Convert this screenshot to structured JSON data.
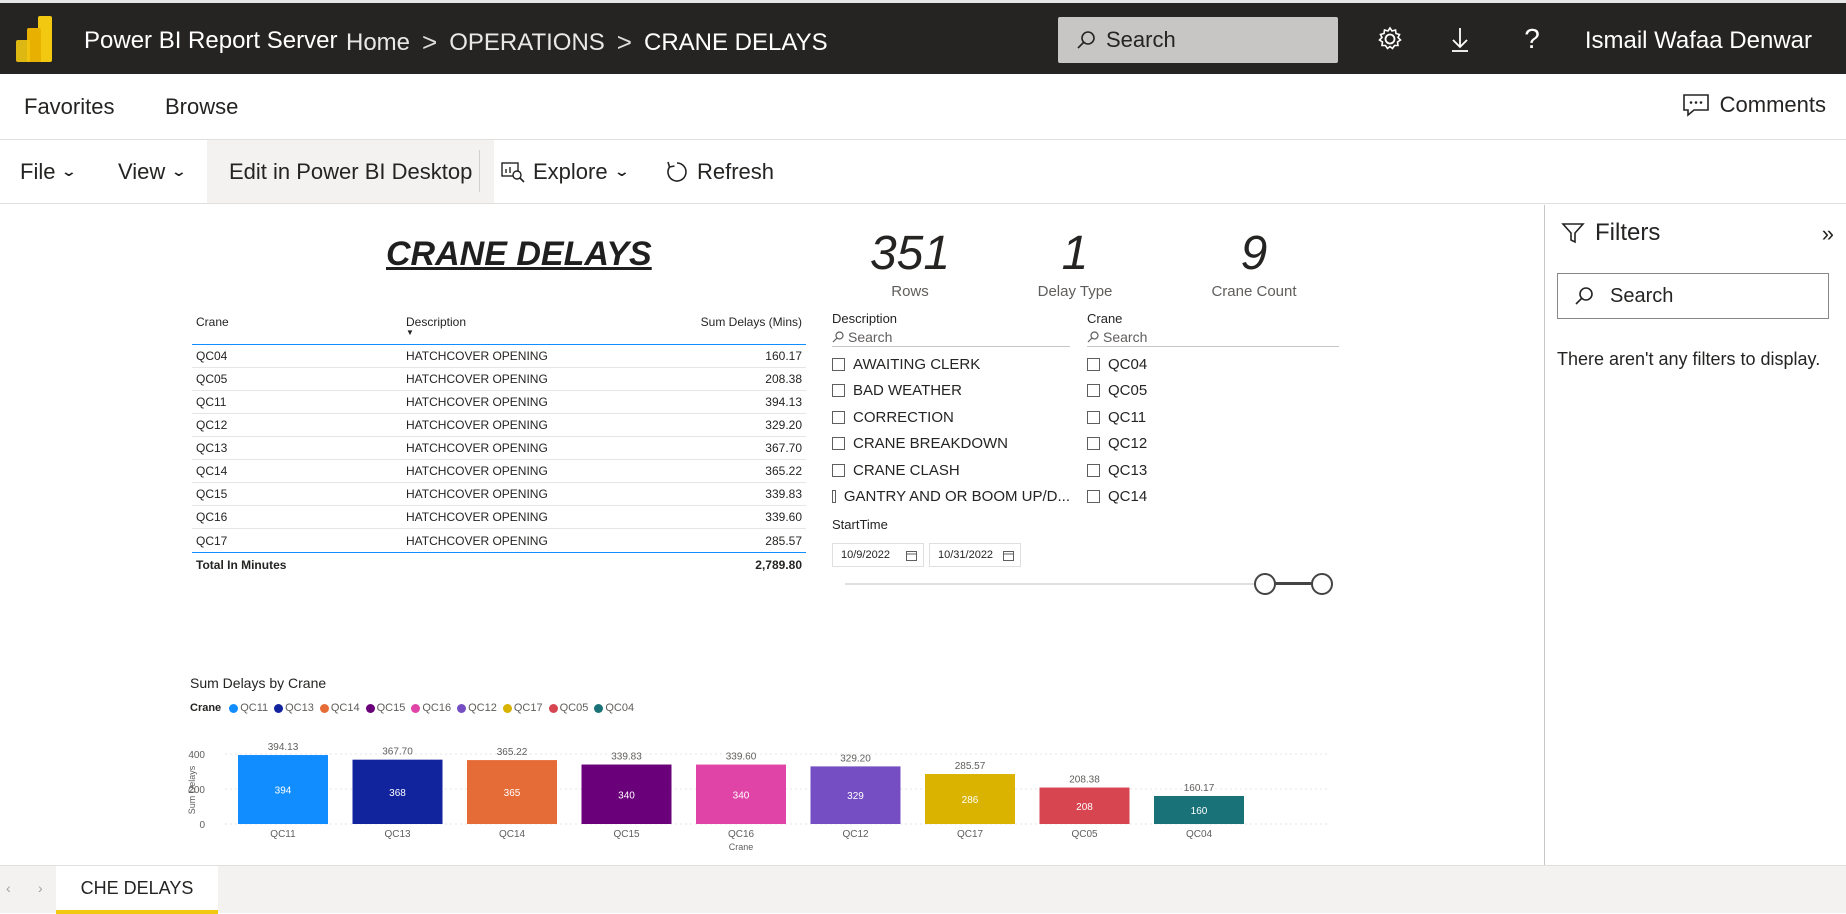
{
  "header": {
    "app_title": "Power BI Report Server",
    "breadcrumbs": [
      "Home",
      "OPERATIONS",
      "CRANE DELAYS"
    ],
    "search_placeholder": "Search",
    "user": "Ismail Wafaa Denwar"
  },
  "nav": {
    "favorites": "Favorites",
    "browse": "Browse",
    "comments": "Comments"
  },
  "toolbar": {
    "file": "File",
    "view": "View",
    "edit": "Edit in Power BI Desktop",
    "explore": "Explore",
    "refresh": "Refresh"
  },
  "report": {
    "title": "CRANE DELAYS",
    "cards": [
      {
        "value": "351",
        "label": "Rows"
      },
      {
        "value": "1",
        "label": "Delay Type"
      },
      {
        "value": "9",
        "label": "Crane Count"
      }
    ],
    "table": {
      "headers": [
        "Crane",
        "Description",
        "Sum Delays (Mins)"
      ],
      "rows": [
        [
          "QC04",
          "HATCHCOVER OPENING",
          "160.17"
        ],
        [
          "QC05",
          "HATCHCOVER OPENING",
          "208.38"
        ],
        [
          "QC11",
          "HATCHCOVER OPENING",
          "394.13"
        ],
        [
          "QC12",
          "HATCHCOVER OPENING",
          "329.20"
        ],
        [
          "QC13",
          "HATCHCOVER OPENING",
          "367.70"
        ],
        [
          "QC14",
          "HATCHCOVER OPENING",
          "365.22"
        ],
        [
          "QC15",
          "HATCHCOVER OPENING",
          "339.83"
        ],
        [
          "QC16",
          "HATCHCOVER OPENING",
          "339.60"
        ],
        [
          "QC17",
          "HATCHCOVER OPENING",
          "285.57"
        ]
      ],
      "total_label": "Total In Minutes",
      "total_value": "2,789.80"
    },
    "desc_slicer": {
      "title": "Description",
      "search": "Search",
      "options": [
        "AWAITING CLERK",
        "BAD WEATHER",
        "CORRECTION",
        "CRANE BREAKDOWN",
        "CRANE CLASH",
        "GANTRY AND OR BOOM UP/D..."
      ]
    },
    "crane_slicer": {
      "title": "Crane",
      "search": "Search",
      "options": [
        "QC04",
        "QC05",
        "QC11",
        "QC12",
        "QC13",
        "QC14"
      ]
    },
    "start_time": {
      "label": "StartTime",
      "from": "10/9/2022",
      "to": "10/31/2022"
    }
  },
  "chart_data": {
    "type": "bar",
    "title": "Sum Delays by Crane",
    "legend_title": "Crane",
    "categories": [
      "QC11",
      "QC13",
      "QC14",
      "QC15",
      "QC16",
      "QC12",
      "QC17",
      "QC05",
      "QC04"
    ],
    "values": [
      394.13,
      367.7,
      365.22,
      339.83,
      339.6,
      329.2,
      285.57,
      208.38,
      160.17
    ],
    "inner_labels": [
      "394",
      "368",
      "365",
      "340",
      "340",
      "329",
      "286",
      "208",
      "160"
    ],
    "top_labels": [
      "394.13",
      "367.70",
      "365.22",
      "339.83",
      "339.60",
      "329.20",
      "285.57",
      "208.38",
      "160.17"
    ],
    "colors": [
      "#118dff",
      "#12239e",
      "#e66c37",
      "#6b007b",
      "#e044a7",
      "#744ec2",
      "#d9b300",
      "#d64550",
      "#197278"
    ],
    "xlabel": "Crane",
    "ylabel": "Sum Delays",
    "yticks": [
      0,
      200,
      400
    ],
    "ylim": [
      0,
      400
    ],
    "grid": true,
    "legend_position": "top-left"
  },
  "filters": {
    "title": "Filters",
    "search": "Search",
    "empty": "There aren't any filters to display."
  },
  "pages": {
    "tab": "CHE DELAYS"
  }
}
